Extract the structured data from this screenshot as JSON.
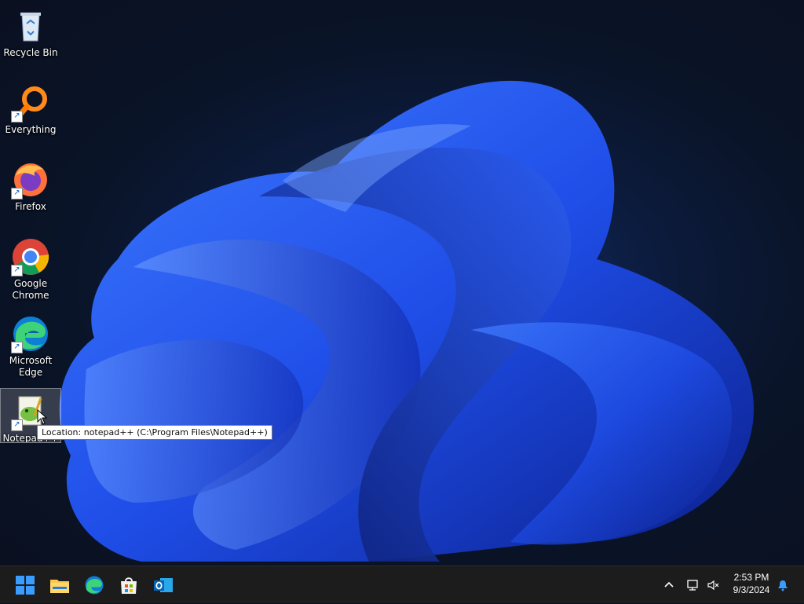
{
  "desktop_icons": [
    {
      "label": "Recycle Bin"
    },
    {
      "label": "Everything"
    },
    {
      "label": "Firefox"
    },
    {
      "label": "Google Chrome"
    },
    {
      "label": "Microsoft Edge"
    },
    {
      "label": "Notepad++"
    }
  ],
  "tooltip": {
    "text": "Location: notepad++ (C:\\Program Files\\Notepad++)"
  },
  "taskbar": {
    "pinned": [
      "start-icon",
      "file-explorer-icon",
      "edge-icon",
      "store-icon",
      "outlook-icon"
    ],
    "tray": {
      "time": "2:53 PM",
      "date": "9/3/2024"
    }
  },
  "colors": {
    "taskbar": "#1c1c1c",
    "accent": "#3b78ff",
    "wallpaper_bloom": "#2f5bff"
  }
}
